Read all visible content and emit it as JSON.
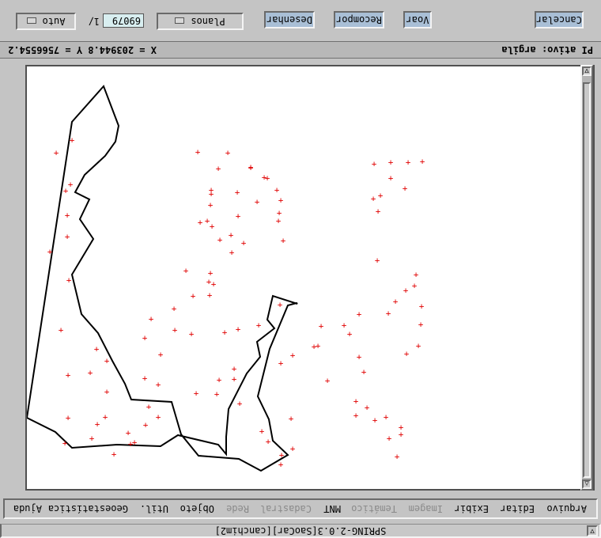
{
  "window": {
    "title": "SPRING-2.0.3[SaoCar][canchim2]",
    "minimize_glyph": "▽"
  },
  "menu": [
    {
      "label": "Arquivo",
      "enabled": true
    },
    {
      "label": "Editar",
      "enabled": true
    },
    {
      "label": "Exibir",
      "enabled": true
    },
    {
      "label": "Imagem",
      "enabled": false
    },
    {
      "label": "Temático",
      "enabled": false
    },
    {
      "label": "MNT",
      "enabled": true
    },
    {
      "label": "Cadastral",
      "enabled": false
    },
    {
      "label": "Rede",
      "enabled": false
    },
    {
      "label": "Objeto",
      "enabled": true
    },
    {
      "label": "Util.",
      "enabled": true
    },
    {
      "label": "Geoestatística",
      "enabled": true
    },
    {
      "label": "Ajuda",
      "enabled": true
    }
  ],
  "status": {
    "coords": "X = 203944.8 Y = 7566554.2",
    "active_pi": "PI ativo: argila"
  },
  "toolbar": {
    "auto_label": "Auto",
    "scale_prefix": "1/",
    "scale_value": "69079",
    "planes_label": "Planos",
    "draw_label": "Desenhar",
    "recompose_label": "Recompor",
    "fly_label": "Voar",
    "cancel_label": "Cancelar"
  },
  "scroll": {
    "up_glyph": "△",
    "down_glyph": "▽"
  },
  "map": {
    "boundary_color": "#000000",
    "sample_color": "#e00000",
    "sample_marker": "+"
  }
}
